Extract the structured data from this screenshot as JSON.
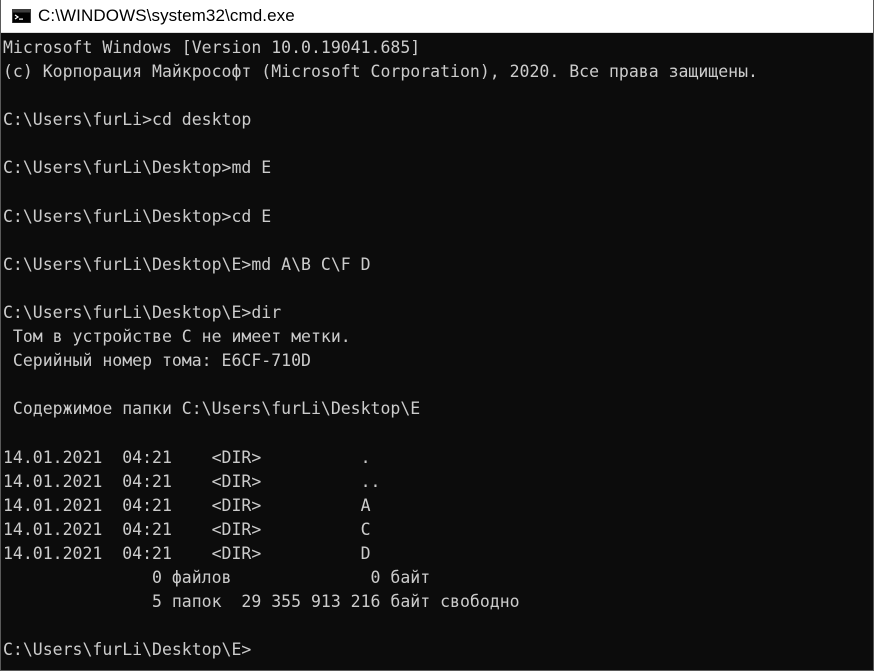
{
  "window": {
    "title": "C:\\WINDOWS\\system32\\cmd.exe",
    "icon": "cmd-console-icon"
  },
  "colors": {
    "console_background": "#0c0c0c",
    "console_text": "#cccccc",
    "titlebar_background": "#ffffff"
  },
  "console": {
    "lines": [
      "Microsoft Windows [Version 10.0.19041.685]",
      "(c) Корпорация Майкрософт (Microsoft Corporation), 2020. Все права защищены.",
      "",
      "C:\\Users\\furLi>cd desktop",
      "",
      "C:\\Users\\furLi\\Desktop>md E",
      "",
      "C:\\Users\\furLi\\Desktop>cd E",
      "",
      "C:\\Users\\furLi\\Desktop\\E>md A\\B C\\F D",
      "",
      "C:\\Users\\furLi\\Desktop\\E>dir",
      " Том в устройстве C не имеет метки.",
      " Серийный номер тома: E6CF-710D",
      "",
      " Содержимое папки C:\\Users\\furLi\\Desktop\\E",
      "",
      "14.01.2021  04:21    <DIR>          .",
      "14.01.2021  04:21    <DIR>          ..",
      "14.01.2021  04:21    <DIR>          A",
      "14.01.2021  04:21    <DIR>          C",
      "14.01.2021  04:21    <DIR>          D",
      "               0 файлов              0 байт",
      "               5 папок  29 355 913 216 байт свободно",
      "",
      "C:\\Users\\furLi\\Desktop\\E>"
    ]
  }
}
